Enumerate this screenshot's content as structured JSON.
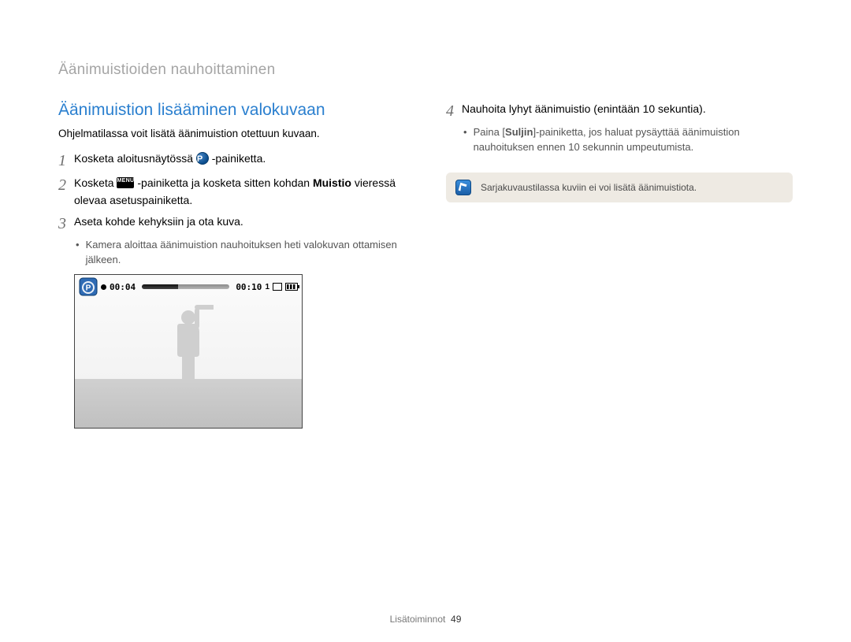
{
  "header": "Äänimuistioiden nauhoittaminen",
  "left": {
    "title": "Äänimuistion lisääminen valokuvaan",
    "intro": "Ohjelmatilassa voit lisätä äänimuistion otettuun kuvaan.",
    "step1": {
      "num": "1",
      "pre": "Kosketa aloitusnäytössä ",
      "post": " -painiketta."
    },
    "step2": {
      "num": "2",
      "pre": "Kosketa ",
      "mid": " -painiketta ja kosketa sitten kohdan ",
      "bold": "Muistio",
      "post": " vieressä olevaa asetuspainiketta."
    },
    "step3": {
      "num": "3",
      "text": "Aseta kohde kehyksiin ja ota kuva.",
      "bullet": "Kamera aloittaa äänimuistion nauhoituksen heti valokuvan ottamisen jälkeen."
    },
    "camera": {
      "time_elapsed": "00:04",
      "time_total": "00:10",
      "count": "1"
    }
  },
  "right": {
    "step4": {
      "num": "4",
      "text": "Nauhoita lyhyt äänimuistio (enintään 10 sekuntia).",
      "bullet_pre": "Paina [",
      "bullet_bold": "Suljin",
      "bullet_post": "]-painiketta, jos haluat pysäyttää äänimuistion nauhoituksen ennen 10 sekunnin umpeutumista."
    },
    "note": "Sarjakuvaustilassa kuviin ei voi lisätä äänimuistiota."
  },
  "footer": {
    "section": "Lisätoiminnot",
    "page": "49"
  },
  "icons": {
    "p": "P",
    "menu": "MENU"
  }
}
